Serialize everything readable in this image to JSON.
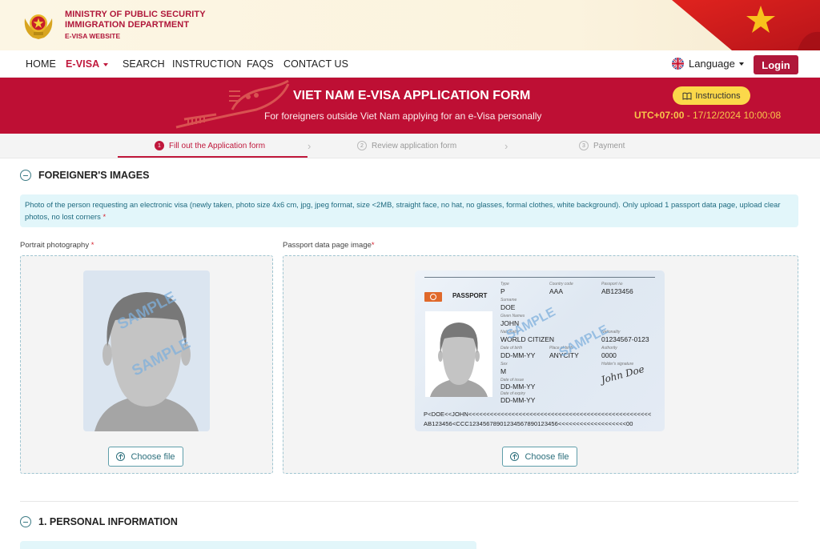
{
  "brand": {
    "line1": "MINISTRY OF PUBLIC SECURITY",
    "line2": "IMMIGRATION DEPARTMENT",
    "line3": "E-VISA WEBSITE",
    "emblem_icon": "police-emblem-icon",
    "flag_icon": "vietnam-flag-icon"
  },
  "nav": {
    "items": [
      {
        "label": "HOME",
        "active": false
      },
      {
        "label": "E-VISA",
        "active": true,
        "has_dropdown": true
      },
      {
        "label": "SEARCH",
        "active": false
      },
      {
        "label": "INSTRUCTION",
        "active": false
      },
      {
        "label": "FAQS",
        "active": false
      },
      {
        "label": "CONTACT US",
        "active": false
      }
    ],
    "language_label": "Language",
    "language_icon": "uk-flag-icon",
    "login_label": "Login"
  },
  "banner": {
    "title": "VIET NAM E-VISA APPLICATION FORM",
    "subtitle": "For foreigners outside Viet Nam applying for an e-Visa personally",
    "instructions_label": "Instructions",
    "instructions_icon": "book-icon",
    "timezone": "UTC+07:00",
    "datetime": "17/12/2024 10:00:08"
  },
  "stepper": {
    "steps": [
      {
        "number": "1",
        "label": "Fill out the Application form",
        "active": true
      },
      {
        "number": "2",
        "label": "Review application form",
        "active": false
      },
      {
        "number": "3",
        "label": "Payment",
        "active": false
      }
    ]
  },
  "images_section": {
    "title": "FOREIGNER'S IMAGES",
    "note": "Photo of the person requesting an electronic visa (newly taken, photo size 4x6 cm, jpg, jpeg format, size <2MB, straight face, no hat, no glasses, formal clothes, white background). Only upload 1 passport data page, upload clear photos, no lost corners",
    "required_mark": "*",
    "portrait": {
      "label": "Portrait photography",
      "watermark": "SAMPLE",
      "choose_label": "Choose file"
    },
    "passport": {
      "label": "Passport data page image",
      "choose_label": "Choose file",
      "watermark": "SAMPLE",
      "card": {
        "heading": "PASSPORT",
        "type_label": "Type",
        "type": "P",
        "country_code_label": "Country code",
        "country_code": "AAA",
        "passport_no_label": "Passport №",
        "passport_no": "AB123456",
        "surname_label": "Surname",
        "surname": "DOE",
        "given_names_label": "Given Names",
        "given_names": "JOHN",
        "nationality_label": "Nationality",
        "nationality": "WORLD CITIZEN",
        "personal_no_label": "Nationality",
        "personal_no": "01234567-0123",
        "dob_label": "Date of birth",
        "dob": "DD-MM-YY",
        "pob_label": "Place of birth",
        "pob": "ANYCITY",
        "authority_label": "Authority",
        "authority": "0000",
        "sex_label": "Sex",
        "sex": "M",
        "signature_label": "Holder's signature",
        "signature": "John Doe",
        "issue_label": "Date of issue",
        "issue": "DD-MM-YY",
        "expiry_label": "Date of expiry",
        "expiry": "DD-MM-YY",
        "mrz1": "P<DOE<<JOHN<<<<<<<<<<<<<<<<<<<<<<<<<<<<<<<<<<<<<<<<<<<<<<<<<<<",
        "mrz2": "AB123456<CCC12345678901234567890123456<<<<<<<<<<<<<<<<<<<00"
      }
    }
  },
  "personal_section": {
    "title": "1. PERSONAL INFORMATION"
  },
  "colors": {
    "brand_red": "#be0f34",
    "accent_yellow": "#fbd84a",
    "teal": "#2c6f7c",
    "note_bg": "#e2f6fa"
  }
}
